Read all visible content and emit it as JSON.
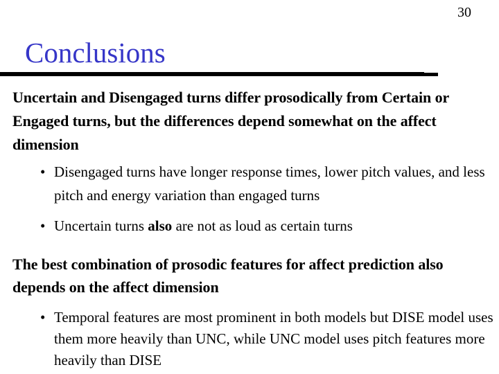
{
  "slide": {
    "page_number": "30",
    "title": "Conclusions",
    "title_color": "#3636c8",
    "paragraphs": [
      {
        "text": "Uncertain and Disengaged turns differ prosodically from Certain or Engaged turns, but the differences depend somewhat on the affect dimension",
        "bullets": [
          {
            "text": "Disengaged turns have longer response times, lower pitch values, and less pitch and energy variation than engaged turns"
          },
          {
            "text_before": "Uncertain turns ",
            "text_bold": "also",
            "text_after": " are not as loud as certain turns"
          }
        ]
      },
      {
        "text": "The best combination of prosodic features for affect prediction also depends on the affect dimension",
        "bullets": [
          {
            "text": "Temporal features are most prominent in both models but DISE model uses them more heavily than UNC, while UNC model uses pitch features more heavily than DISE"
          }
        ]
      }
    ],
    "bullet_glyph": "•"
  }
}
